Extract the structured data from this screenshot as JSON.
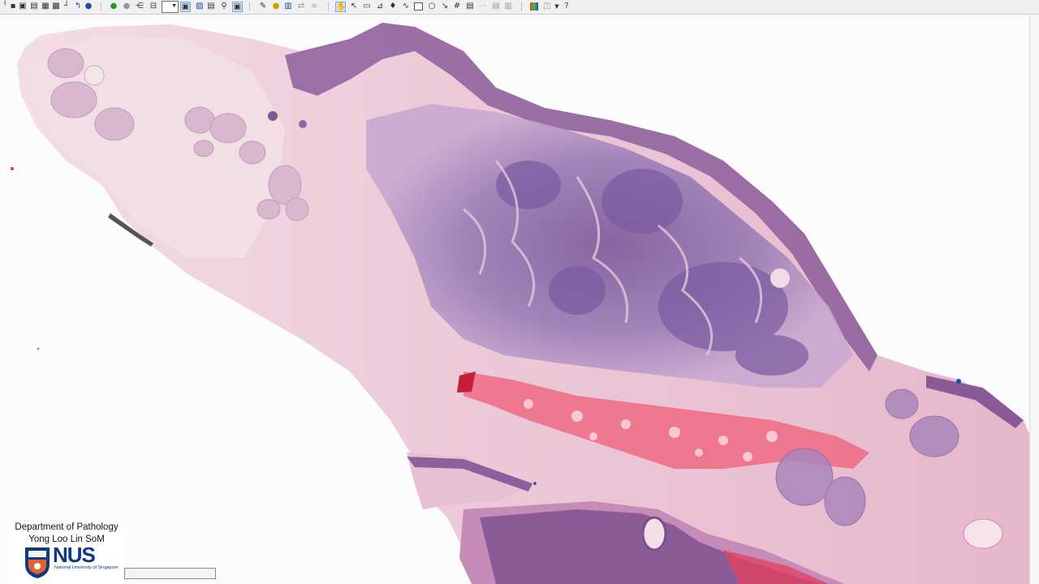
{
  "viewer": {
    "toolbar": {
      "icons": [
        "pin-icon",
        "camera-icon",
        "open-slide-icon",
        "print-icon",
        "image-stack-icon",
        "back-arrow-icon",
        "info-icon",
        "go-forward-icon",
        "refresh-icon",
        "share-icon",
        "zoom-select",
        "fit-icon",
        "copy-icon",
        "save-icon",
        "magnifier-icon",
        "image-export-icon",
        "annotation-icon",
        "highlight-icon",
        "compare-icon",
        "sync-icon",
        "link-icon",
        "pan-hand-icon",
        "select-arrow-icon",
        "slide-icon",
        "measure-icon",
        "marker-icon",
        "rectangle-icon",
        "ellipse-icon",
        "arrow-icon",
        "grid-icon",
        "text-box-icon",
        "ruler-icon",
        "layers-icon",
        "copy-layer-icon",
        "color-adjust-icon",
        "rotate-icon",
        "help-icon"
      ]
    }
  },
  "overlay": {
    "department": "Department of Pathology",
    "school": "Yong Loo Lin SoM",
    "logo_text": "NUS",
    "logo_subtitle": "National University of Singapore",
    "logo_color": "#0b3a86"
  },
  "colors": {
    "tissue_pink": "#eec5d6",
    "tumor_purple": "#8a6aa6",
    "epidermis_purple": "#7d4e8c",
    "hemorrhage_red": "#ea3a55",
    "background": "#fcfcfc"
  }
}
